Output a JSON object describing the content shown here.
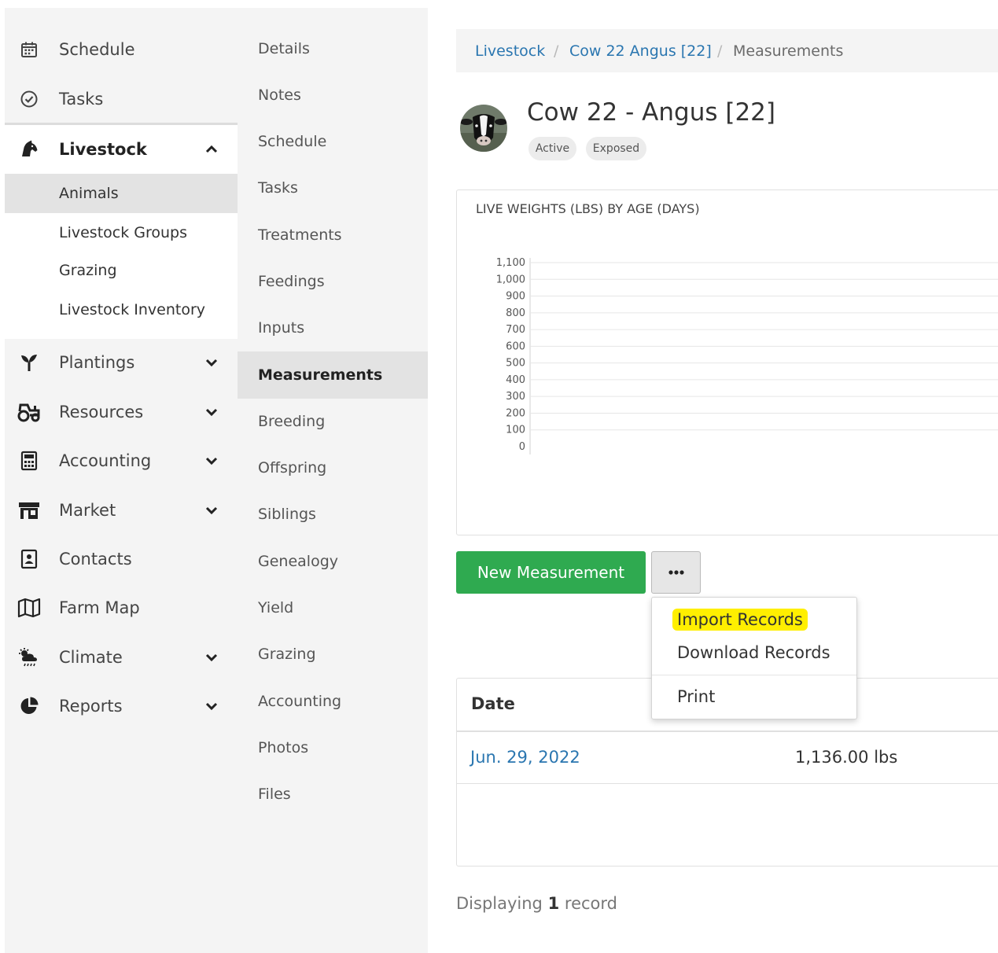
{
  "main_nav": {
    "schedule": "Schedule",
    "tasks": "Tasks",
    "livestock": "Livestock",
    "livestock_sub": [
      "Animals",
      "Livestock Groups",
      "Grazing",
      "Livestock Inventory"
    ],
    "plantings": "Plantings",
    "resources": "Resources",
    "accounting": "Accounting",
    "market": "Market",
    "contacts": "Contacts",
    "farm_map": "Farm Map",
    "climate": "Climate",
    "reports": "Reports"
  },
  "secondary_nav": [
    "Details",
    "Notes",
    "Schedule",
    "Tasks",
    "Treatments",
    "Feedings",
    "Inputs",
    "Measurements",
    "Breeding",
    "Offspring",
    "Siblings",
    "Genealogy",
    "Yield",
    "Grazing",
    "Accounting",
    "Photos",
    "Files"
  ],
  "breadcrumb": {
    "root": "Livestock",
    "animal": "Cow 22 Angus [22]",
    "current": "Measurements",
    "separator": "/"
  },
  "animal": {
    "title": "Cow 22 - Angus [22]",
    "badges": [
      "Active",
      "Exposed"
    ]
  },
  "chart_data": {
    "type": "line",
    "title": "LIVE WEIGHTS (LBS) BY AGE (DAYS)",
    "y_ticks": [
      "1,100",
      "1,000",
      "900",
      "800",
      "700",
      "600",
      "500",
      "400",
      "300",
      "200",
      "100",
      "0"
    ],
    "ylim": [
      0,
      1100
    ],
    "series": [],
    "grid": true
  },
  "actions": {
    "new_measurement": "New Measurement",
    "more": "•••"
  },
  "dropdown": {
    "import": "Import Records",
    "download": "Download Records",
    "print": "Print",
    "highlight_color": "#ffef00"
  },
  "table": {
    "header_date": "Date",
    "rows": [
      {
        "date": "Jun. 29, 2022",
        "value": "1,136.00 lbs"
      }
    ]
  },
  "footer": {
    "prefix": "Displaying",
    "count": "1",
    "suffix": "record"
  },
  "colors": {
    "primary_button": "#2faa50",
    "link": "#2a76b0"
  }
}
